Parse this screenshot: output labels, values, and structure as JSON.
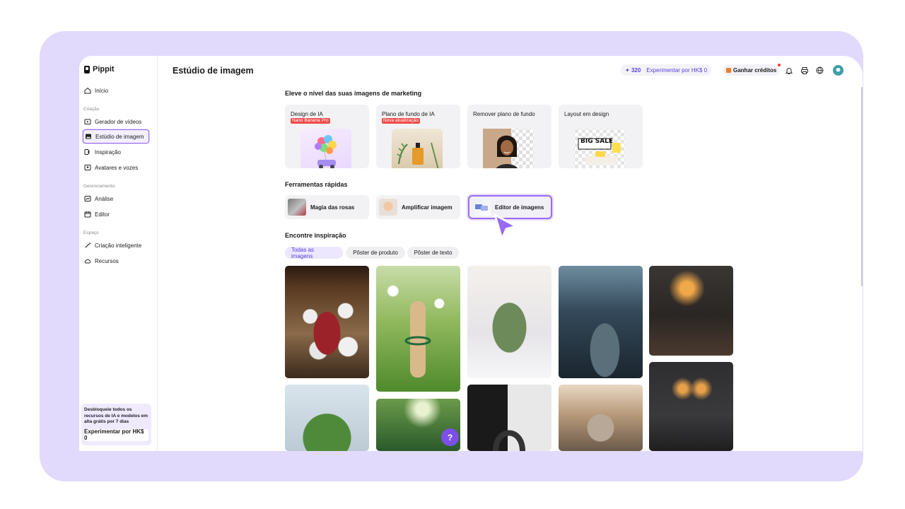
{
  "brand": {
    "name": "Pippit"
  },
  "sidebar": {
    "home": "Início",
    "sections": [
      {
        "label": "Criação",
        "items": [
          "Gerador de vídeos",
          "Estúdio de imagem",
          "Inspiração",
          "Avatares e vozes"
        ]
      },
      {
        "label": "Gerenciamento",
        "items": [
          "Análise",
          "Editor"
        ]
      },
      {
        "label": "Espaço",
        "items": [
          "Criação inteligente",
          "Recursos"
        ]
      }
    ],
    "active_item": "Estúdio de imagem",
    "promo": {
      "text": "Desbloqueie todos os recursos de IA e modelos em alta grátis por 7 dias",
      "button": "Experimentar por HK$ 0"
    }
  },
  "header": {
    "title": "Estúdio de imagem",
    "credits": "320",
    "try_label": "Experimentar por HK$ 0",
    "earn_label": "Ganhar créditos",
    "icons": [
      "bell-icon",
      "printer-icon",
      "globe-pt-icon",
      "avatar"
    ]
  },
  "marketing": {
    "title": "Eleve o nível das suas imagens de marketing",
    "cards": [
      {
        "label": "Design de IA",
        "badge": "Nano Banana Pro"
      },
      {
        "label": "Plano de fundo de IA",
        "badge": "Nova atualização"
      },
      {
        "label": "Remover plano de fundo",
        "badge": ""
      },
      {
        "label": "Layout em design",
        "badge": ""
      }
    ],
    "sale_text": "BIG SALE"
  },
  "quick_tools": {
    "title": "Ferramentas rápidas",
    "items": [
      "Magia das rosas",
      "Amplificar imagem",
      "Editor de imagens"
    ]
  },
  "inspiration": {
    "title": "Encontre inspiração",
    "filters": [
      "Todas as imagens",
      "Pôster de produto",
      "Pôster de texto"
    ],
    "active_filter": "Todas as imagens"
  },
  "help": {
    "label": "?"
  },
  "colors": {
    "accent": "#7b4fe8",
    "frame": "#e2dafc",
    "badge": "#ef4b4b"
  }
}
